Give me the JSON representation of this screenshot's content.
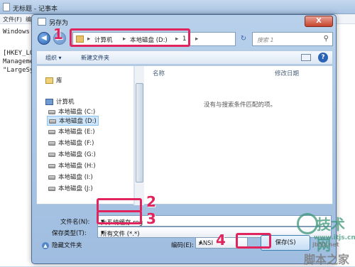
{
  "notepad": {
    "title": "无标题 - 记事本",
    "menu": [
      "文件(F)",
      "编"
    ],
    "lines": [
      "Windows",
      "",
      "[HKEY_LO",
      "Manageme",
      "\"LargeSy"
    ]
  },
  "dialog": {
    "title": "另存为",
    "close_label": "X",
    "breadcrumb": [
      "计算机",
      "本地磁盘 (D:)",
      "1"
    ],
    "search_placeholder": "搜索 1",
    "toolbar": {
      "organize": "组织 ▾",
      "new_folder": "新建文件夹"
    },
    "tree": [
      {
        "label": "库",
        "kind": "folder"
      },
      {
        "label": "计算机",
        "kind": "pc"
      },
      {
        "label": "本地磁盘 (C:)",
        "kind": "disk"
      },
      {
        "label": "本地磁盘 (D:)",
        "kind": "disk",
        "selected": true
      },
      {
        "label": "本地磁盘 (E:)",
        "kind": "disk"
      },
      {
        "label": "本地磁盘 (F:)",
        "kind": "disk"
      },
      {
        "label": "本地磁盘 (G:)",
        "kind": "disk"
      },
      {
        "label": "本地磁盘 (H:)",
        "kind": "disk"
      },
      {
        "label": "本地磁盘 (I:)",
        "kind": "disk"
      },
      {
        "label": "本地磁盘 (J:)",
        "kind": "disk"
      }
    ],
    "columns": {
      "name": "名称",
      "modified": "修改日期"
    },
    "empty_message": "没有与搜索条件匹配的项。",
    "filename_label": "文件名(N):",
    "filename_value": "大系统缓存.reg",
    "filetype_label": "保存类型(T):",
    "filetype_value": "所有文件 (*.*)",
    "hide_folders": "隐藏文件夹",
    "encoding_label": "编码(E):",
    "encoding_value": "ANSI",
    "save_label": "保存(S)"
  },
  "annotations": [
    "1",
    "2",
    "3",
    "4"
  ],
  "watermark": {
    "site": "技术网",
    "url": "www.itjs.cn",
    "cn": "脚本之家",
    "small": "jb51.net"
  },
  "colors": {
    "annotation": "#e0245e",
    "accent": "#2a62b5"
  }
}
